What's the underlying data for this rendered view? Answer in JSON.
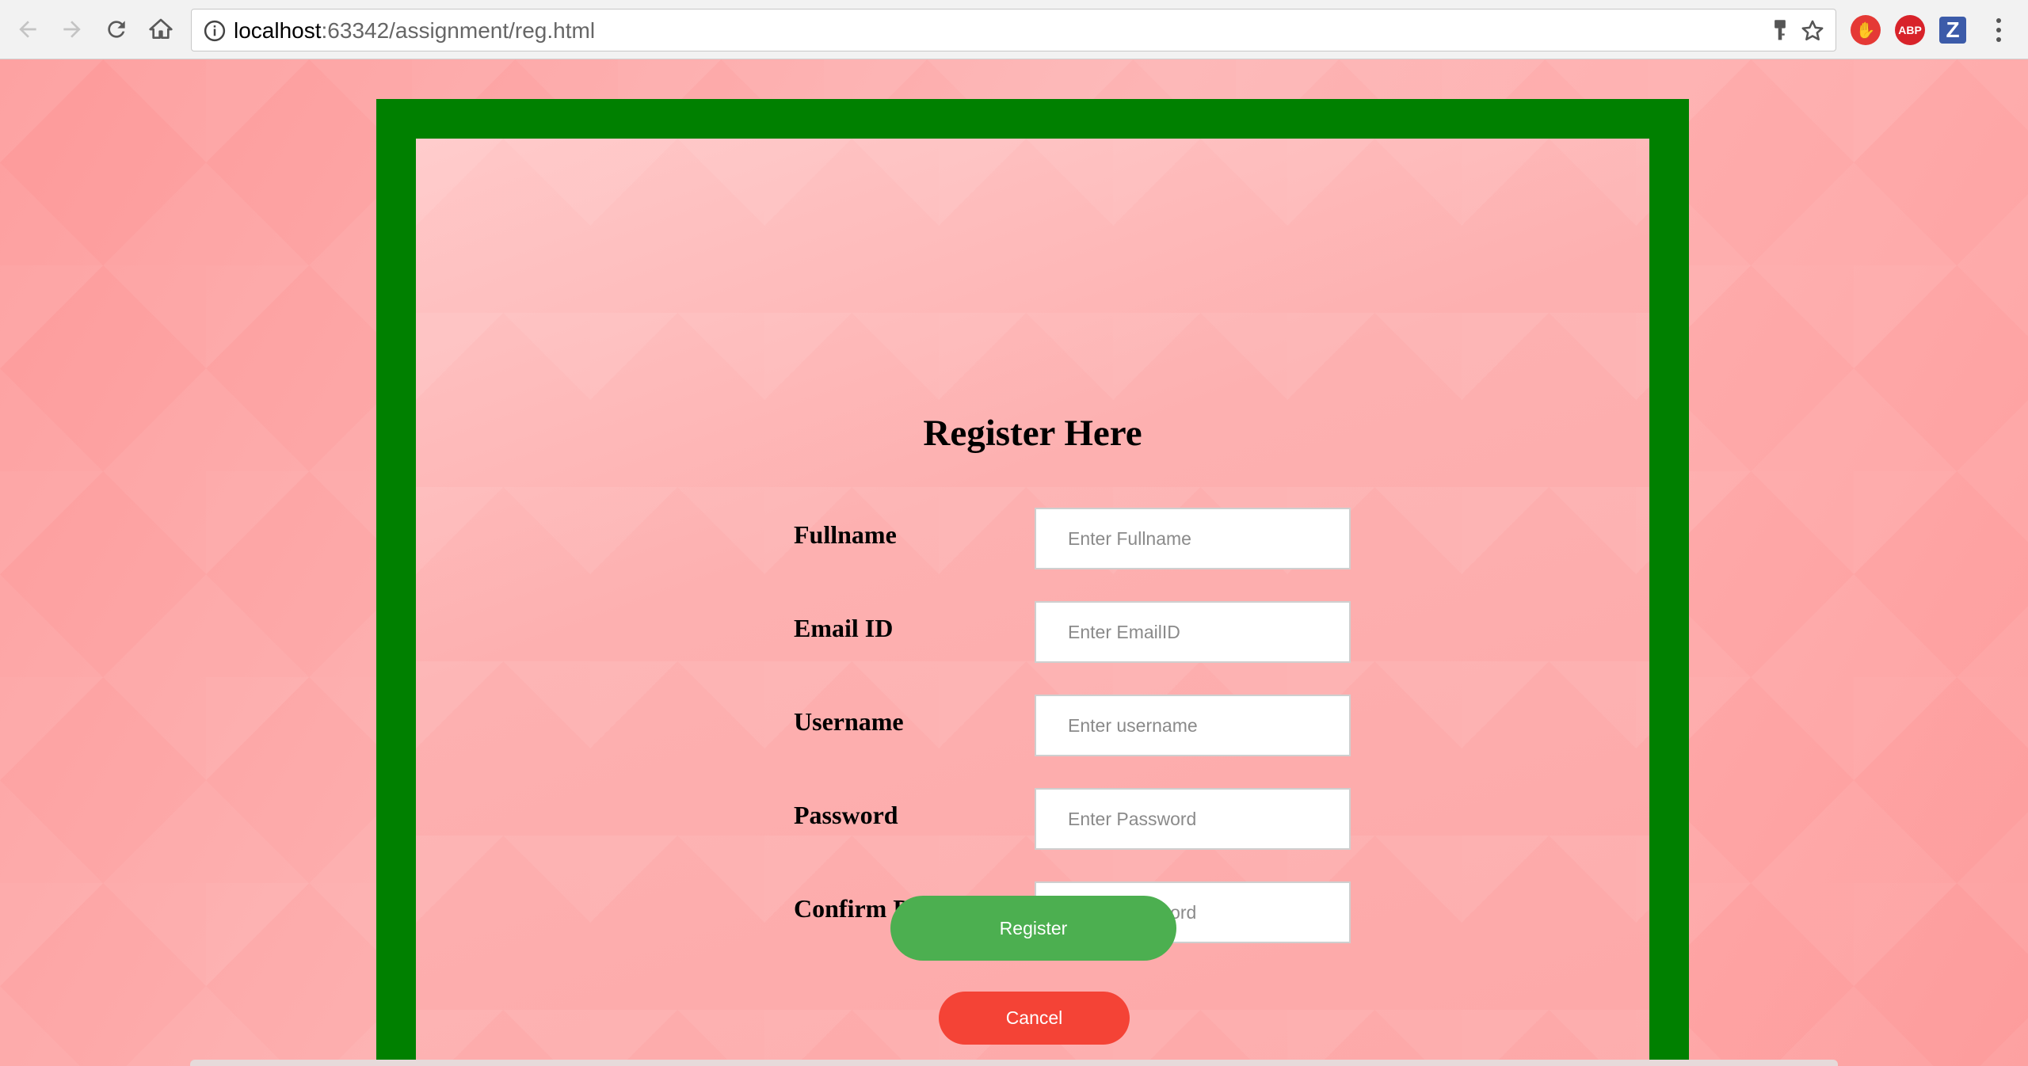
{
  "browser": {
    "url_host": "localhost",
    "url_rest": ":63342/assignment/reg.html",
    "extensions": [
      {
        "name": "hand-extension",
        "glyph": "✋"
      },
      {
        "name": "adblock-plus",
        "glyph": "ABP"
      },
      {
        "name": "z-extension",
        "glyph": "Z"
      }
    ]
  },
  "form": {
    "title": "Register Here",
    "fields": [
      {
        "label": "Fullname",
        "placeholder": "Enter Fullname"
      },
      {
        "label": "Email ID",
        "placeholder": "Enter EmailID"
      },
      {
        "label": "Username",
        "placeholder": "Enter username"
      },
      {
        "label": "Password",
        "placeholder": "Enter Password"
      },
      {
        "label": "Confirm Password",
        "placeholder": "Enter Password"
      }
    ],
    "register_label": "Register",
    "cancel_label": "Cancel"
  },
  "colors": {
    "frame_border": "#008000",
    "register_button": "#4caf50",
    "cancel_button": "#f44336",
    "page_background": "#fcaaaa"
  }
}
